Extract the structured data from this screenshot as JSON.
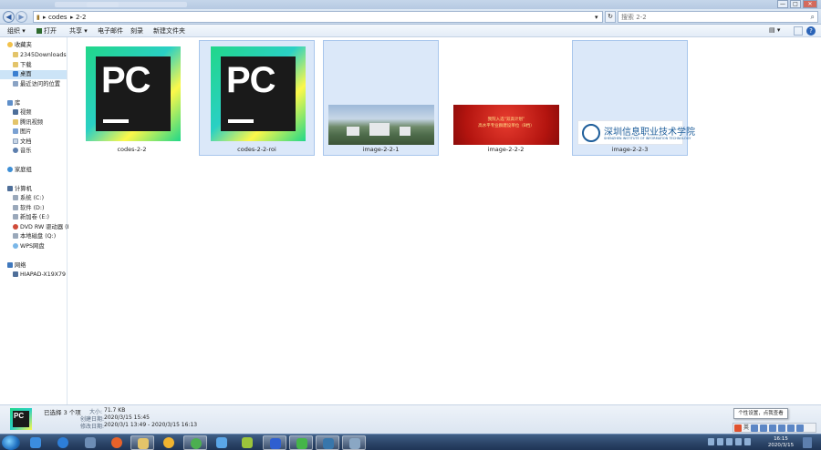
{
  "topbar": {
    "window_buttons": [
      "—",
      "□",
      "✕"
    ]
  },
  "address": {
    "back": "◀",
    "forward": "▶",
    "crumbs": [
      "codes",
      "2-2"
    ],
    "search_placeholder": "搜索 2-2",
    "refresh": "↻"
  },
  "toolbar": {
    "organize": "组织 ▾",
    "open": "打开",
    "share": "共享 ▾",
    "email": "电子邮件",
    "burn": "刻录",
    "new_folder": "新建文件夹",
    "view": "▤ ▾",
    "help": "?"
  },
  "sidebar": {
    "favorites": "收藏夹",
    "fav_items": [
      "2345Downloads",
      "下载",
      "桌面",
      "最近访问的位置"
    ],
    "libraries": "库",
    "lib_items": [
      "视频",
      "腾讯视频",
      "图片",
      "文档",
      "音乐"
    ],
    "homegroup": "家庭组",
    "computer": "计算机",
    "drives": [
      "系统 (C:)",
      "软件 (D:)",
      "新加卷 (E:)",
      "DVD RW 驱动器 (F:",
      "本地磁盘 (Q:)",
      "WPS网盘"
    ],
    "network": "网络",
    "net_items": [
      "HIAPAD-X19X79"
    ]
  },
  "files": [
    {
      "name": "codes-2-2",
      "selected": false
    },
    {
      "name": "codes-2-2-roi",
      "selected": true
    },
    {
      "name": "image-2-2-1",
      "selected": true
    },
    {
      "name": "image-2-2-2",
      "selected": false
    },
    {
      "name": "image-2-2-3",
      "selected": true
    }
  ],
  "thumbs": {
    "pc_text": "PC",
    "banner_line1": "我院入选“双高计划”",
    "banner_line2": "高水平专业群建设单位（B档）",
    "school_cn": "深圳信息职业技术学院",
    "school_en": "SHENZHEN INSTITUTE OF INFORMATION TECHNOLOGY"
  },
  "details": {
    "selected_count": "已选择 3 个项",
    "size_label": "大小:",
    "size_value": "71.7 KB",
    "created_label": "创建日期:",
    "created_value": "2020/3/15 15:45",
    "modified_label": "修改日期:",
    "modified_value": "2020/3/1 13:49 - 2020/3/15 16:13"
  },
  "tooltip": "个性设置，点我查看",
  "ime": {
    "lang": "英"
  },
  "clock": {
    "time": "16:15",
    "date": "2020/3/15"
  }
}
